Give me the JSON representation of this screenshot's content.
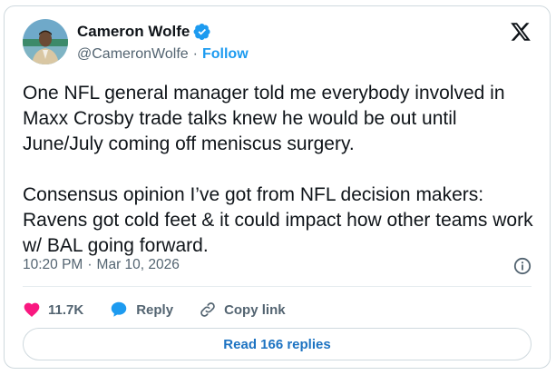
{
  "author": {
    "display_name": "Cameron Wolfe",
    "handle": "@CameronWolfe",
    "follow_label": "Follow",
    "separator": "·"
  },
  "tweet": {
    "text": "One NFL general manager told me everybody involved in Maxx Crosby trade talks knew he would be out until June/July coming off meniscus surgery.\n\nConsensus opinion I’ve got from NFL decision makers: Ravens got cold feet & it could impact how other teams work w/ BAL going forward.",
    "time": "10:20 PM",
    "date": "Mar 10, 2026",
    "separator": "·"
  },
  "actions": {
    "likes": "11.7K",
    "reply_label": "Reply",
    "copy_link_label": "Copy link"
  },
  "replies_button": {
    "label": "Read 166 replies"
  },
  "icons": {
    "verified": "verified-badge-icon",
    "x_logo": "x-logo-icon",
    "info": "info-icon",
    "heart": "heart-icon",
    "reply": "reply-bubble-icon",
    "link": "link-icon"
  },
  "colors": {
    "accent": "#1d9bf0",
    "heart": "#f91880",
    "text": "#0f1419",
    "muted": "#536471",
    "border": "#cfd9de"
  }
}
